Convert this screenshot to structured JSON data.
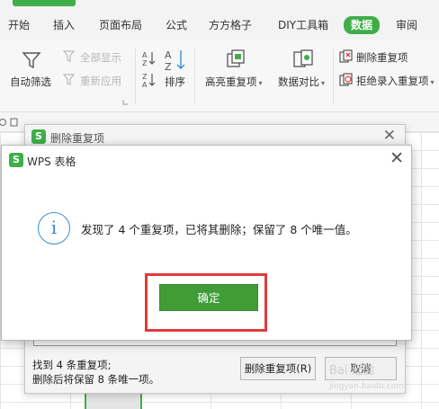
{
  "ribbon": {
    "tabs": [
      {
        "label": "开始",
        "active": false
      },
      {
        "label": "插入",
        "active": false
      },
      {
        "label": "页面布局",
        "active": false
      },
      {
        "label": "公式",
        "active": false
      },
      {
        "label": "方方格子",
        "active": false
      },
      {
        "label": "DIY工具箱",
        "active": false
      },
      {
        "label": "数据",
        "active": true
      },
      {
        "label": "审阅",
        "active": false
      }
    ],
    "auto_filter": "自动筛选",
    "show_all": "全部显示",
    "reapply": "重新应用",
    "sort": "排序",
    "highlight_duplicates": "高亮重复项",
    "data_compare": "数据对比",
    "remove_duplicates": "删除重复项",
    "reject_duplicates": "拒绝录入重复项"
  },
  "back_dialog": {
    "title": "删除重复项",
    "found_line1": "找到 4 条重复项;",
    "found_line2": "删除后将保留 8 条唯一项。",
    "remove_button": "删除重复项(R)",
    "cancel_button": "取消"
  },
  "message_dialog": {
    "app_title": "WPS 表格",
    "message": "发现了 4 个重复项，已将其删除；保留了 8 个唯一值。",
    "ok_button": "确定"
  },
  "colors": {
    "brand_green": "#3fae49",
    "ok_green": "#3f9c36",
    "highlight_red": "#e03a3a",
    "info_blue": "#3a8fd6"
  }
}
